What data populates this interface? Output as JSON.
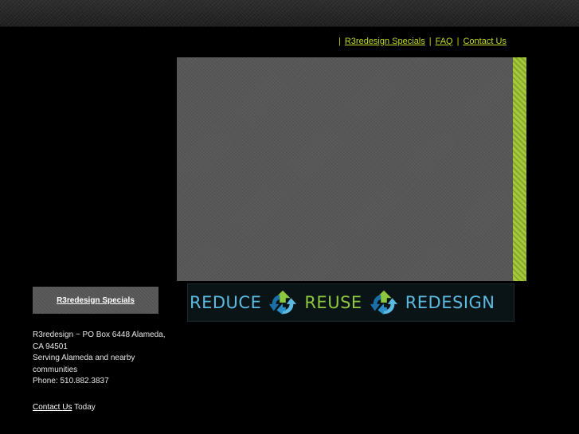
{
  "nav": {
    "separator": "|",
    "links": [
      {
        "label": "R3redesign Specials"
      },
      {
        "label": "FAQ"
      },
      {
        "label": "Contact Us"
      }
    ]
  },
  "banner": {
    "word1": "REDUCE",
    "word2": "REUSE",
    "word3": "REDESIGN"
  },
  "sidebar": {
    "button_label": "R3redesign Specials",
    "address_line1": "R3redesign ~ PO Box 6448 Alameda, CA 94501",
    "address_line2": "Serving Alameda and nearby communities",
    "phone": "Phone: 510.882.3837",
    "contact_link": "Contact Us",
    "contact_suffix": " Today"
  },
  "colors": {
    "background": "#000000",
    "nav_link": "#c8dc2a",
    "accent_stripe": "#a6c93a",
    "hero": "#575757",
    "banner_blue": "#5cb9e0",
    "banner_green": "#8dc63f"
  },
  "icons": [
    "recycle-icon"
  ]
}
